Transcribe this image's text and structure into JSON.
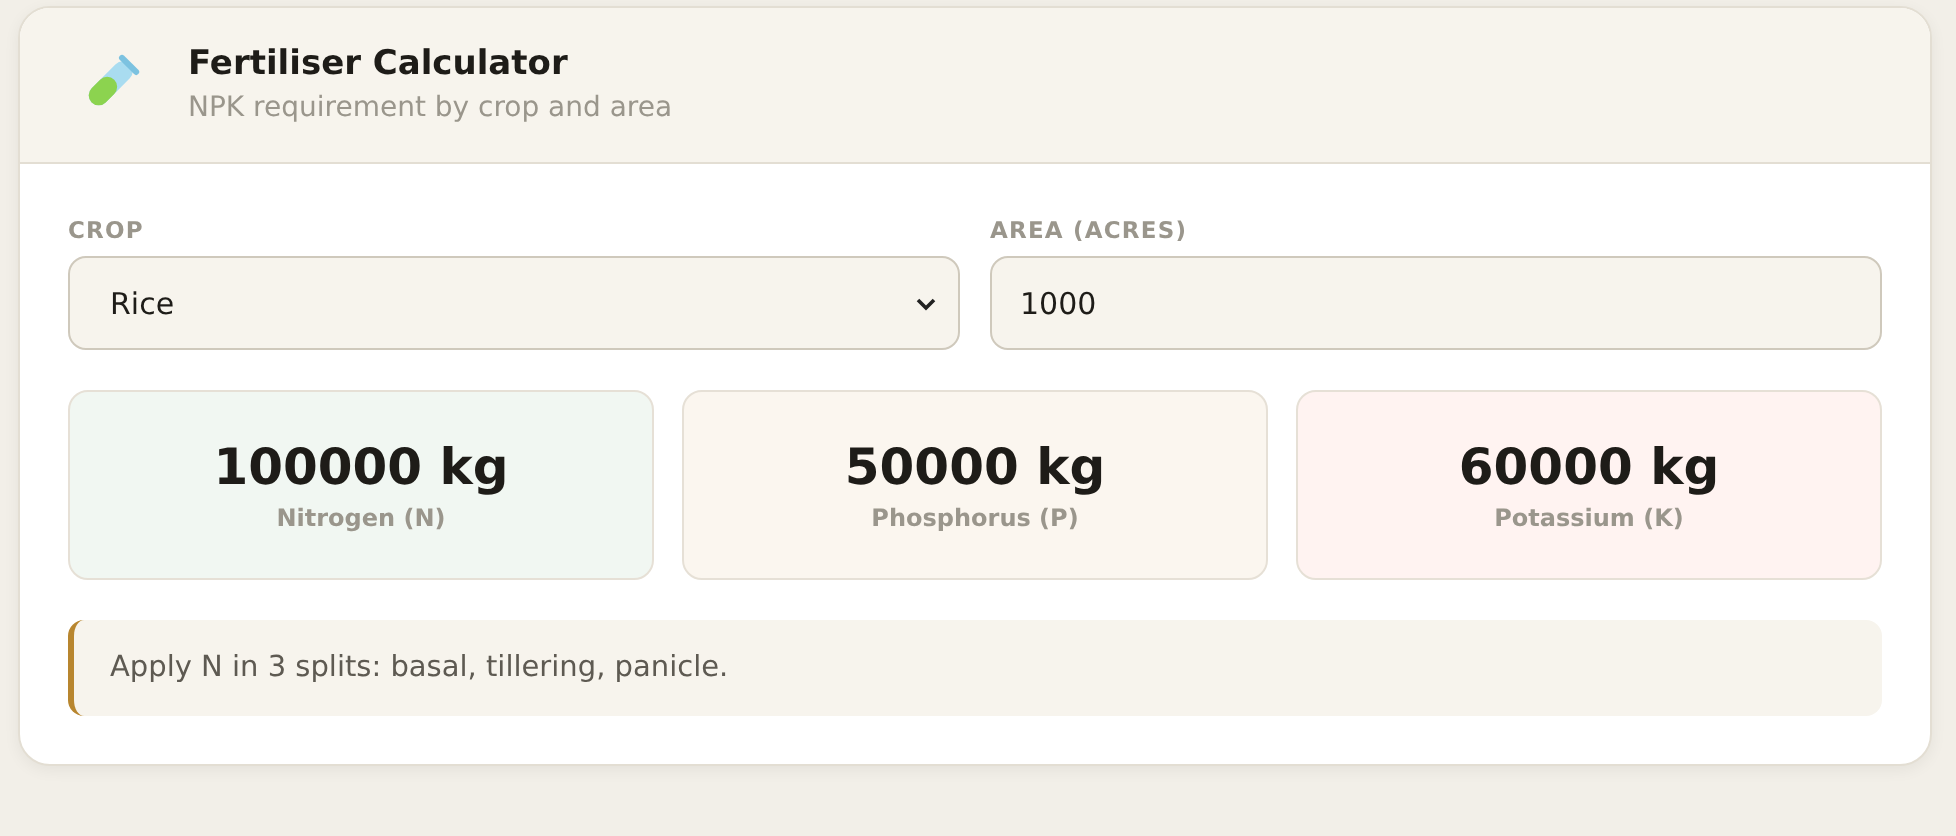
{
  "header": {
    "title": "Fertiliser Calculator",
    "subtitle": "NPK requirement by crop and area"
  },
  "fields": [
    {
      "kind": "select",
      "label": "CROP",
      "value": "Rice"
    },
    {
      "kind": "input",
      "label": "AREA (ACRES)",
      "value": "1000"
    }
  ],
  "results": [
    {
      "value": "100000 kg",
      "label": "Nitrogen (N)",
      "color": "#f1f7f2"
    },
    {
      "value": "50000 kg",
      "label": "Phosphorus (P)",
      "color": "#fbf6ef"
    },
    {
      "value": "60000 kg",
      "label": "Potassium (K)",
      "color": "#fff3f1"
    }
  ],
  "note": "Apply N in 3 splits: basal, tillering, panicle."
}
